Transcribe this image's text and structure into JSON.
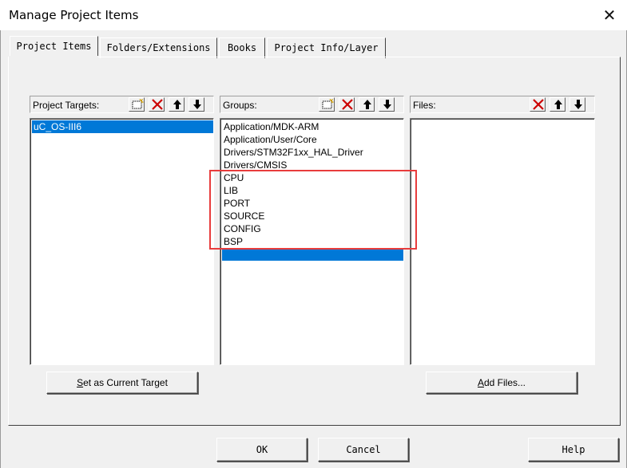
{
  "window": {
    "title": "Manage Project Items",
    "close_glyph": "✕"
  },
  "tabs": [
    {
      "label": "Project Items",
      "active": true
    },
    {
      "label": "Folders/Extensions",
      "active": false
    },
    {
      "label": "Books",
      "active": false
    },
    {
      "label": "Project Info/Layer",
      "active": false
    }
  ],
  "targets": {
    "label": "Project Targets:",
    "items": [
      "uC_OS-III6"
    ],
    "selected_index": 0
  },
  "groups": {
    "label": "Groups:",
    "items": [
      "Application/MDK-ARM",
      "Application/User/Core",
      "Drivers/STM32F1xx_HAL_Driver",
      "Drivers/CMSIS",
      "CPU",
      "LIB",
      "PORT",
      "SOURCE",
      "CONFIG",
      "BSP",
      ""
    ],
    "selected_index": 10
  },
  "files": {
    "label": "Files:",
    "items": []
  },
  "buttons": {
    "set_target_pre": "",
    "set_target_ul": "S",
    "set_target_post": "et as Current Target",
    "add_files_pre": "",
    "add_files_ul": "A",
    "add_files_post": "dd Files...",
    "ok": "OK",
    "cancel": "Cancel",
    "help": "Help"
  },
  "icons": {
    "new": "new-item-icon",
    "delete": "delete-x-icon",
    "up": "move-up-arrow-icon",
    "down": "move-down-arrow-icon"
  },
  "colors": {
    "selection": "#0078d7",
    "delete_red": "#cc0000",
    "annotation": "#e83c3c"
  }
}
